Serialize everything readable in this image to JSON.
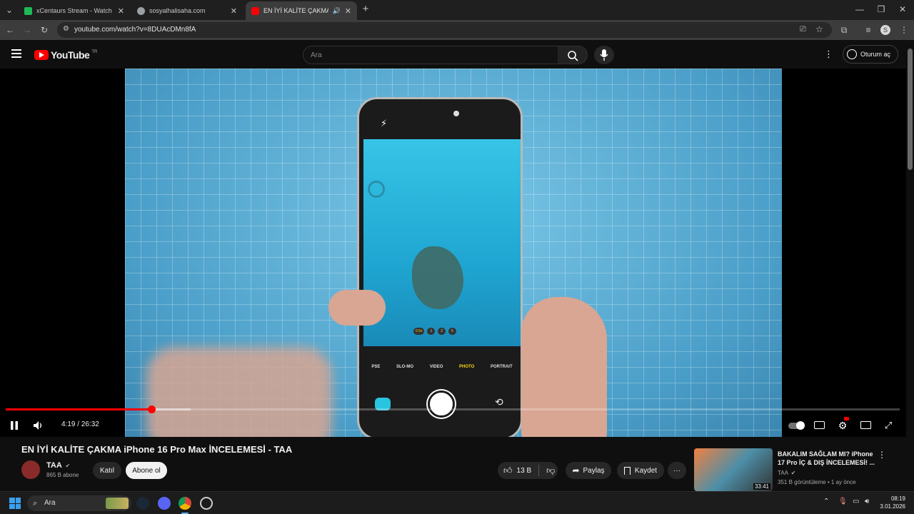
{
  "browser": {
    "tabs": [
      {
        "title": "xCentaurs Stream - Watch Live",
        "favicon_color": "#1db954"
      },
      {
        "title": "sosyalhalisaha.com",
        "favicon_color": "#9aa0a6"
      },
      {
        "title": "EN İYİ KALİTE ÇAKMA iPho",
        "favicon_color": "#ff0000"
      }
    ],
    "url": "youtube.com/watch?v=8DUAcDMn8fA"
  },
  "youtube": {
    "logo_text": "YouTube",
    "region": "TR",
    "search_placeholder": "Ara",
    "signin_label": "Oturum aç"
  },
  "player": {
    "time_display": "4:19 / 26:32",
    "progress_played": 0.163,
    "progress_loaded": 0.207,
    "camera_modes": [
      "PSE",
      "SLO-MO",
      "VIDEO",
      "PHOTO",
      "PORTRAIT"
    ],
    "camera_selected_mode": "PHOTO",
    "zoom_options": [
      "0.5x",
      "1",
      "2",
      "5"
    ]
  },
  "video": {
    "title": "EN İYİ KALİTE ÇAKMA iPhone 16 Pro Max İNCELEMESİ - TAA",
    "channel": "TAA",
    "subscribers": "865 B abone",
    "join_label": "Katıl",
    "subscribe_label": "Abone ol",
    "likes": "13 B",
    "share_label": "Paylaş",
    "save_label": "Kaydet"
  },
  "recommendation": {
    "title": "BAKALIM SAĞLAM MI? iPhone 17 Pro İÇ & DIŞ İNCELEMESİ! ...",
    "channel": "TAA",
    "meta": "351 B görüntüleme • 1 ay önce",
    "duration": "33:41"
  },
  "taskbar": {
    "search_label": "Ara",
    "time": "08:19",
    "date": "3.01.2026"
  }
}
